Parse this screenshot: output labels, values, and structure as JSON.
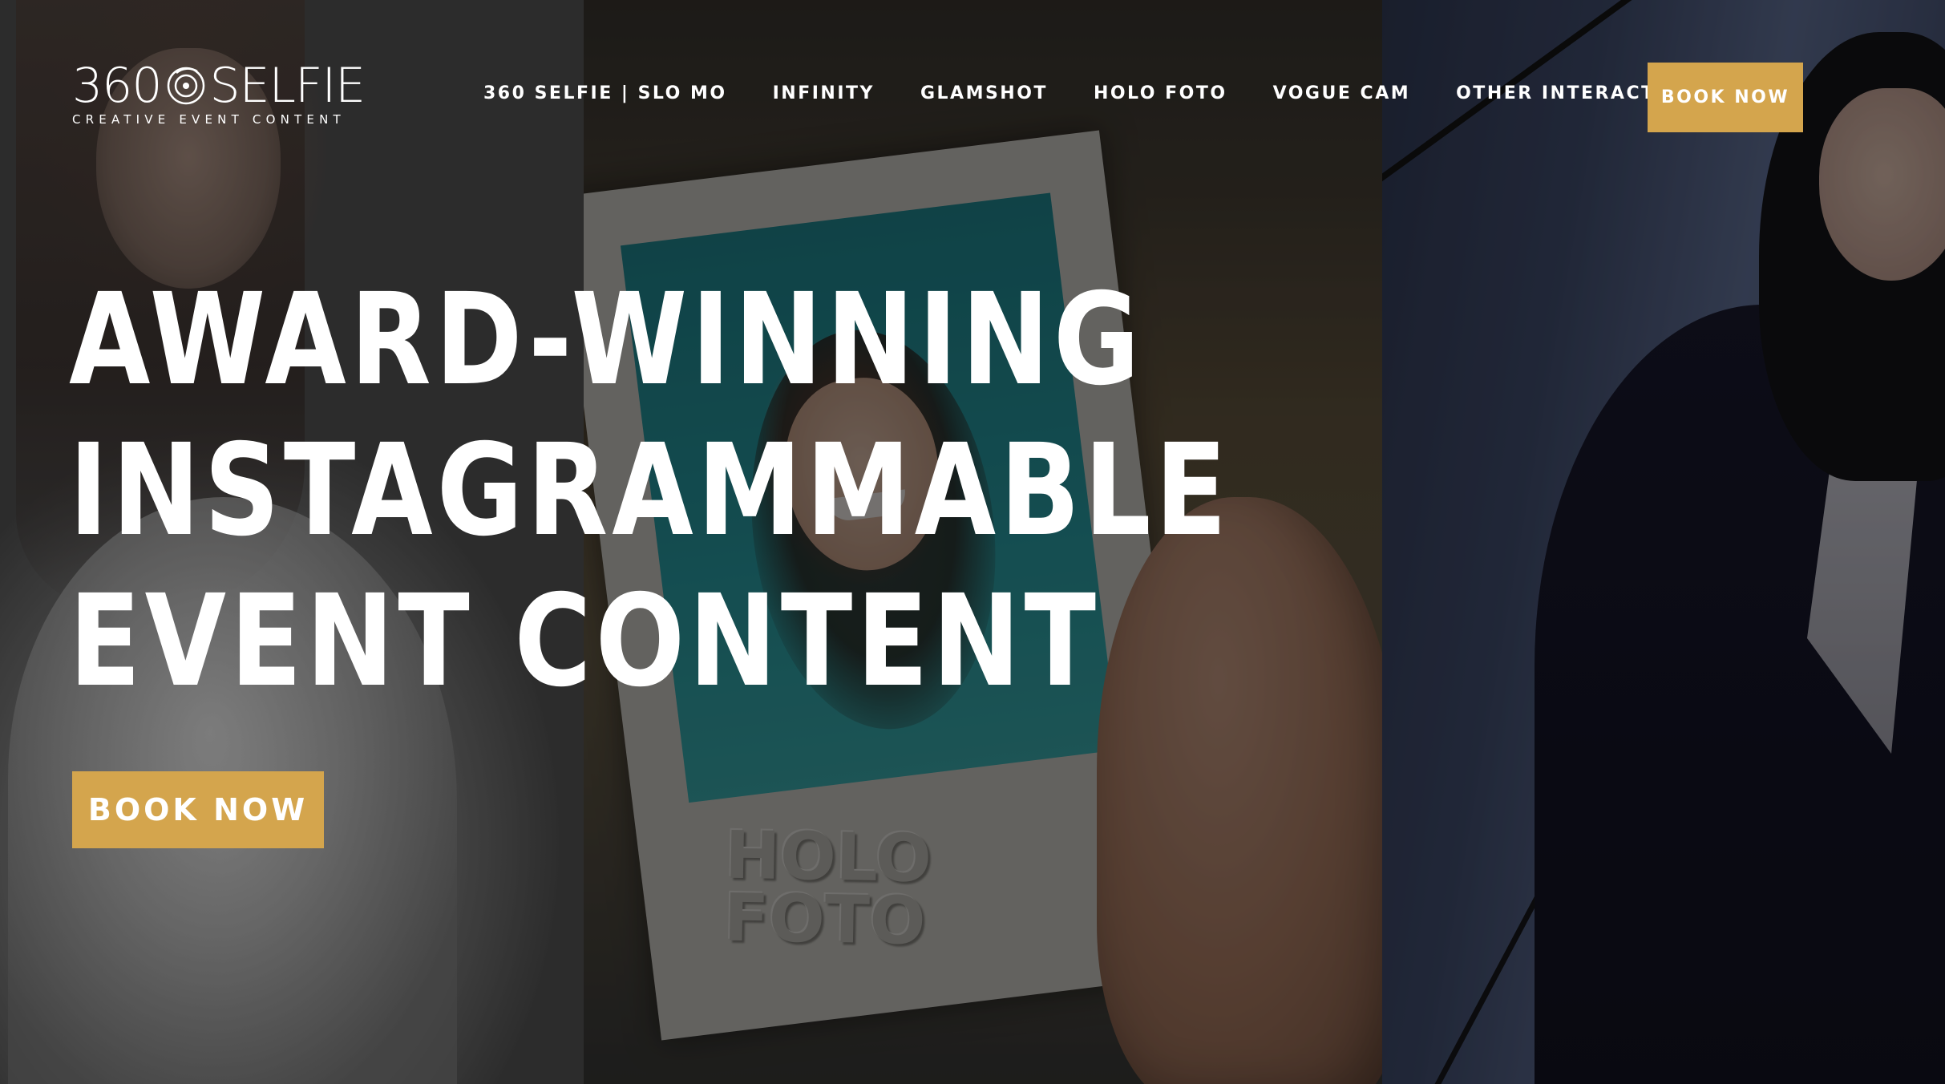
{
  "brand": {
    "logo_main": "360 SELFIE",
    "logo_prefix": "360",
    "logo_suffix": "SELFIE",
    "tagline": "CREATIVE EVENT CONTENT"
  },
  "nav": {
    "items": [
      {
        "label": "360 SELFIE | SLO MO"
      },
      {
        "label": "INFINITY"
      },
      {
        "label": "GLAMSHOT"
      },
      {
        "label": "HOLO FOTO"
      },
      {
        "label": "VOGUE CAM"
      },
      {
        "label": "OTHER INTERACTIVE STUFF"
      }
    ],
    "cta_label": "BOOK NOW"
  },
  "hero": {
    "headline_lines": [
      "AWARD-WINNING",
      "INSTAGRAMMABLE",
      "EVENT CONTENT"
    ],
    "cta_label": "BOOK NOW",
    "polaroid_emboss_line1": "HOLO",
    "polaroid_emboss_line2": "FOTO"
  },
  "colors": {
    "accent_gold": "#d4a54d",
    "text_white": "#ffffff"
  },
  "icons": {
    "logo_lens": "camera-lens-icon"
  }
}
